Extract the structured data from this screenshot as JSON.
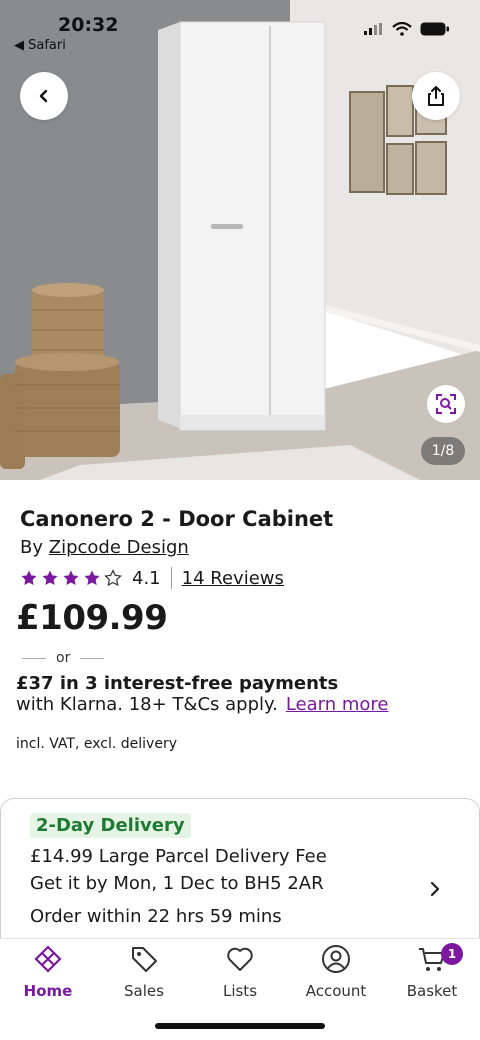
{
  "status_bar": {
    "time": "20:32",
    "back_app": "◀ Safari"
  },
  "gallery": {
    "counter": "1/8"
  },
  "product": {
    "title": "Canonero 2 - Door Cabinet",
    "by_prefix": "By",
    "brand": "Zipcode Design",
    "rating": "4.1",
    "rating_stars": 4,
    "reviews_link": "14 Reviews",
    "price": "£109.99"
  },
  "payment": {
    "or": "or",
    "klarna_headline": "£37 in 3 interest-free payments",
    "klarna_detail": "with Klarna. 18+ T&Cs apply.",
    "learn_more": "Learn more",
    "vat_note": "incl. VAT, excl. delivery"
  },
  "delivery": {
    "badge": "2-Day Delivery",
    "fee": "£14.99 Large Parcel Delivery Fee",
    "eta": "Get it by Mon, 1 Dec to BH5 2AR",
    "cutoff": "Order within 22 hrs 59 mins"
  },
  "nav": {
    "items": [
      {
        "label": "Home",
        "icon": "home-icon"
      },
      {
        "label": "Sales",
        "icon": "tag-icon"
      },
      {
        "label": "Lists",
        "icon": "heart-icon"
      },
      {
        "label": "Account",
        "icon": "account-icon"
      },
      {
        "label": "Basket",
        "icon": "cart-icon"
      }
    ],
    "basket_count": "1"
  },
  "colors": {
    "accent": "#7b189f",
    "delivery_green": "#1f7a34",
    "delivery_bg": "#e6f4e6"
  }
}
